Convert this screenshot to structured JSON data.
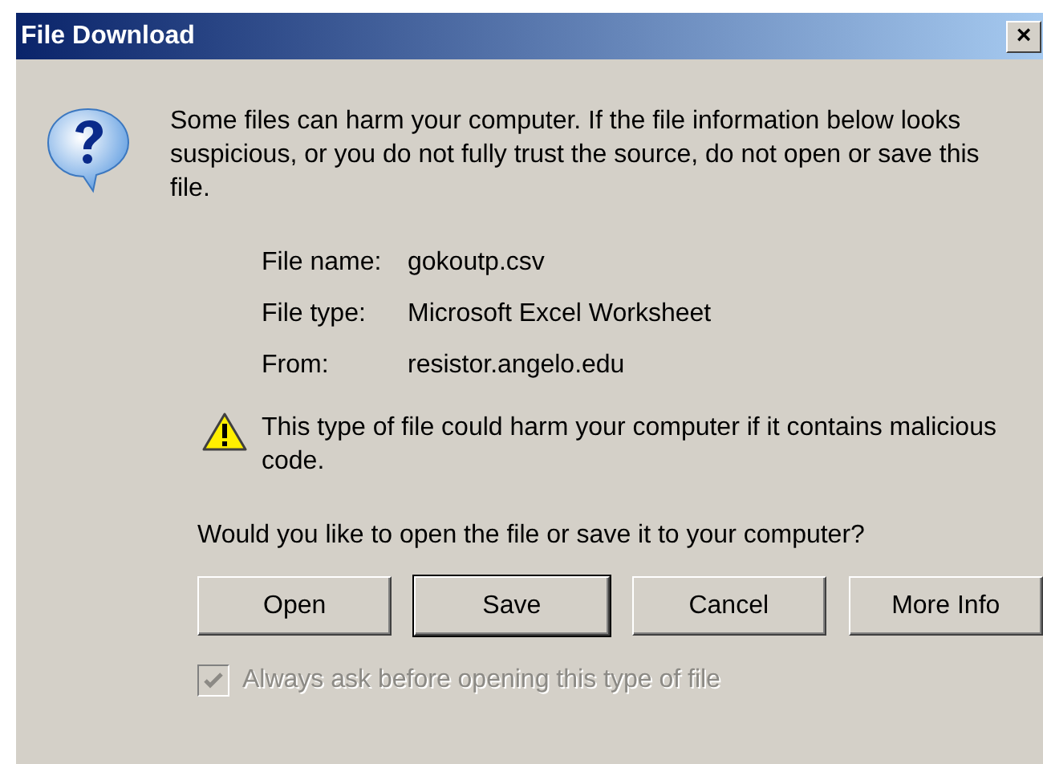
{
  "window": {
    "title": "File Download",
    "close": "×"
  },
  "message": "Some files can harm your computer. If the file information below looks suspicious, or you do not fully trust the source, do not open or save this file.",
  "details": [
    {
      "label": "File name:",
      "value": "gokoutp.csv"
    },
    {
      "label": "File type:",
      "value": "Microsoft Excel Worksheet"
    },
    {
      "label": "From:",
      "value": "resistor.angelo.edu"
    }
  ],
  "warning": "This type of file could harm your computer if it contains malicious code.",
  "question": "Would you like to open the file or save it to your computer?",
  "buttons": [
    {
      "label": "Open",
      "default": false
    },
    {
      "label": "Save",
      "default": true
    },
    {
      "label": "Cancel",
      "default": false
    },
    {
      "label": "More Info",
      "default": false
    }
  ],
  "checkbox": {
    "label": "Always ask before opening this type of file",
    "checked": true,
    "disabled": true
  }
}
